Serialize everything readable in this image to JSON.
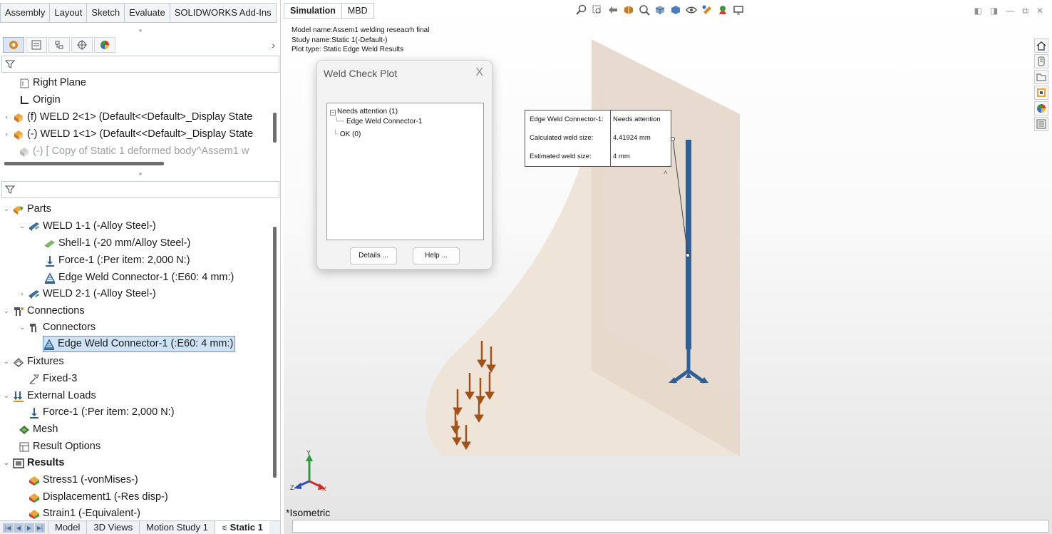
{
  "command_tabs": [
    "Assembly",
    "Layout",
    "Sketch",
    "Evaluate",
    "SOLIDWORKS Add-Ins"
  ],
  "feature_tree": {
    "items": [
      {
        "label": "Right Plane"
      },
      {
        "label": "Origin"
      },
      {
        "label": "(f) WELD 2<1> (Default<<Default>_Display State"
      },
      {
        "label": "(-) WELD 1<1> (Default<<Default>_Display State"
      },
      {
        "label": "(-) [ Copy of Static 1 deformed body^Assem1 w"
      }
    ]
  },
  "study_tree": {
    "items": [
      {
        "label": "Parts"
      },
      {
        "label": "WELD 1-1 (-Alloy Steel-)"
      },
      {
        "label": "Shell-1 (-20 mm/Alloy Steel-)"
      },
      {
        "label": "Force-1 (:Per item: 2,000 N:)"
      },
      {
        "label": "Edge Weld Connector-1 (:E60: 4 mm:)"
      },
      {
        "label": "WELD 2-1 (-Alloy Steel-)"
      },
      {
        "label": "Connections"
      },
      {
        "label": "Connectors"
      },
      {
        "label": "Edge Weld Connector-1 (:E60: 4 mm:)"
      },
      {
        "label": "Fixtures"
      },
      {
        "label": "Fixed-3"
      },
      {
        "label": "External Loads"
      },
      {
        "label": "Force-1 (:Per item: 2,000 N:)"
      },
      {
        "label": "Mesh"
      },
      {
        "label": "Result Options"
      },
      {
        "label": "Results"
      },
      {
        "label": "Stress1 (-vonMises-)"
      },
      {
        "label": "Displacement1 (-Res disp-)"
      },
      {
        "label": "Strain1 (-Equivalent-)"
      }
    ]
  },
  "bottom_tabs": [
    "Model",
    "3D Views",
    "Motion Study 1",
    "Static 1"
  ],
  "viewport": {
    "tabs": [
      "Simulation",
      "MBD"
    ],
    "model_info": {
      "model_name": "Model name:Assem1 welding reseacrh final",
      "study_name": "Study name:Static 1(-Default-)",
      "plot_type": "Plot type: Static Edge Weld Results"
    },
    "view_label": "*Isometric",
    "triad": {
      "x": "X",
      "y": "Y",
      "z": "Z"
    }
  },
  "weld_dialog": {
    "title": "Weld Check Plot",
    "close": "X",
    "tree": {
      "needs_attention": "Needs attention (1)",
      "child": "Edge Weld Connector-1",
      "ok": "OK (0)"
    },
    "details_button": "Details ...",
    "help_button": "Help ..."
  },
  "weld_info": {
    "rows": [
      {
        "label": "Edge Weld Connector-1:",
        "value": "Needs attention"
      },
      {
        "label": "Calculated weld size:",
        "value": "4.41924 mm"
      },
      {
        "label": "Estimated weld size:",
        "value": "4 mm"
      }
    ]
  },
  "colors": {
    "accent": "#2f5f94",
    "selection": "#cfe3f6",
    "force_arrow": "#a0521a",
    "plane_fill": "#e6d9cc",
    "ground_fill": "#efe4d8"
  }
}
